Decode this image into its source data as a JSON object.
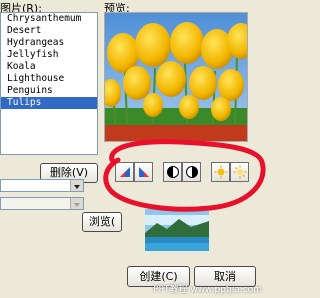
{
  "labels": {
    "picture_label": "图片(R):",
    "preview_label": "预览:"
  },
  "picture_list": {
    "items": [
      "Chrysanthemum",
      "Desert",
      "Hydrangeas",
      "Jellyfish",
      "Koala",
      "Lighthouse",
      "Penguins",
      "Tulips"
    ],
    "selected": "Tulips"
  },
  "buttons": {
    "delete": "删除(V)",
    "browse": "浏览(",
    "create": "创建(C)",
    "cancel": "取消"
  },
  "toolbar_icons": [
    "rotate-left-icon",
    "rotate-right-icon",
    "contrast-decrease-icon",
    "contrast-increase-icon",
    "brightness-decrease-icon",
    "brightness-increase-icon"
  ],
  "colors": {
    "selection": "#316ac5",
    "annotation": "#e8102a"
  },
  "watermark": "PPT教程 www.pptjia.com"
}
